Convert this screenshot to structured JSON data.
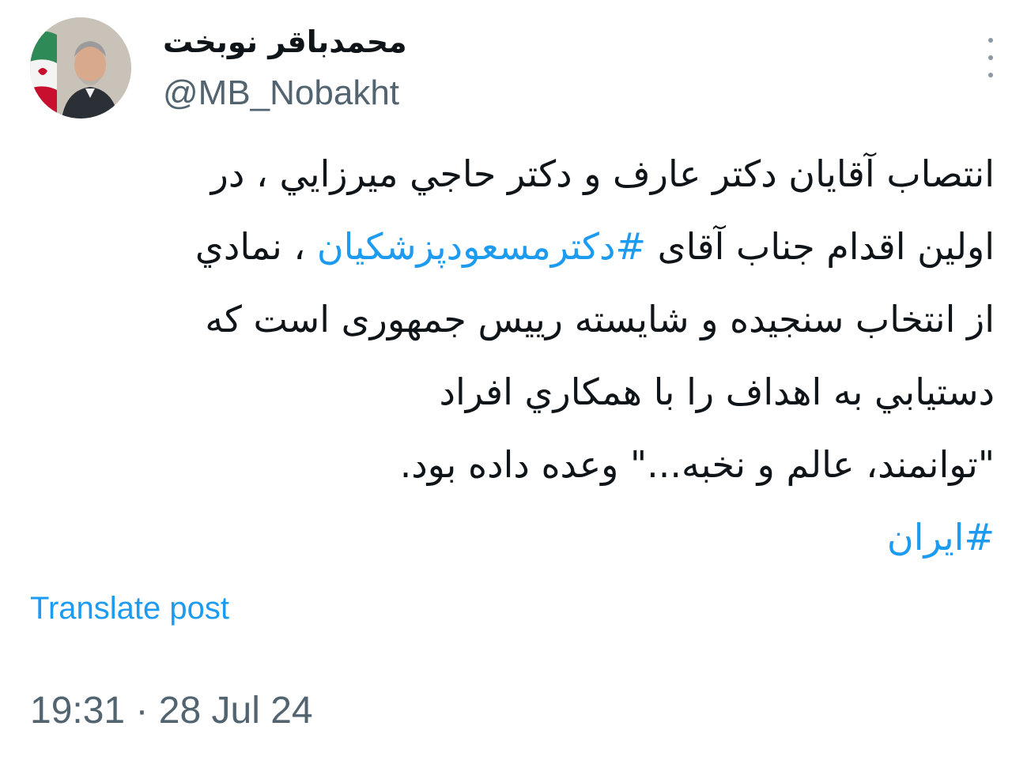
{
  "author": {
    "display_name": "محمدباقر نوبخت",
    "handle": "@MB_Nobakht",
    "avatar_icon": "profile-photo"
  },
  "tweet": {
    "lines": [
      {
        "segments": [
          {
            "text": "انتصاب آقایان دکتر عارف و دکتر حاجي ميرزايي ، در",
            "hashtag": false
          }
        ]
      },
      {
        "segments": [
          {
            "text": "اولین اقدام جناب آقای ",
            "hashtag": false
          },
          {
            "text": "#دکترمسعودپزشکیان",
            "hashtag": true
          },
          {
            "text": " ، نمادي",
            "hashtag": false
          }
        ]
      },
      {
        "segments": [
          {
            "text": "از انتخاب سنجيده و شايسته رييس جمهوری است که",
            "hashtag": false
          }
        ]
      },
      {
        "segments": [
          {
            "text": "دستيابي به اهداف را با همکاري افراد",
            "hashtag": false
          }
        ]
      },
      {
        "segments": [
          {
            "text": "\"توانمند، عالم و نخبه...\" وعده داده بود.",
            "hashtag": false
          }
        ]
      }
    ],
    "hashtag_line": "#ایران"
  },
  "translate_label": "Translate post",
  "timestamp": "19:31 · 28 Jul 24",
  "colors": {
    "link": "#1d9bf0",
    "secondary_text": "#536471",
    "primary_text": "#0f1419",
    "background": "#ffffff"
  },
  "more_icon": "more-vertical-icon"
}
